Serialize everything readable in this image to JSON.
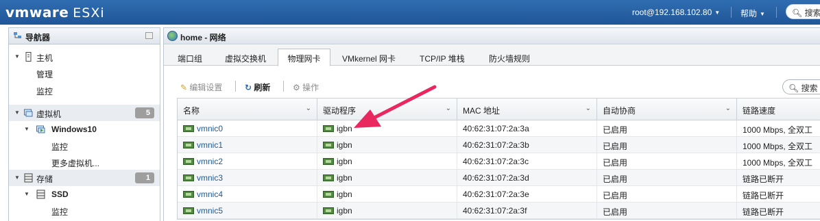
{
  "topbar": {
    "logo_vm": "vmware",
    "logo_esxi": "ESXi",
    "user": "root@192.168.102.80",
    "help": "帮助",
    "search": "搜索"
  },
  "navigator": {
    "title": "导航器",
    "items": [
      {
        "label": "主机"
      },
      {
        "label": "管理"
      },
      {
        "label": "监控"
      },
      {
        "label": "虚拟机",
        "count": "5"
      },
      {
        "label": "Windows10"
      },
      {
        "label": "监控"
      },
      {
        "label": "更多虚拟机..."
      },
      {
        "label": "存储",
        "count": "1"
      },
      {
        "label": "SSD"
      },
      {
        "label": "监控"
      }
    ]
  },
  "main": {
    "title": "home - 网络",
    "tabs": [
      {
        "label": "端口组"
      },
      {
        "label": "虚拟交换机"
      },
      {
        "label": "物理网卡"
      },
      {
        "label": "VMkernel 网卡"
      },
      {
        "label": "TCP/IP 堆栈"
      },
      {
        "label": "防火墙规则"
      }
    ],
    "toolbar": {
      "edit": "编辑设置",
      "refresh": "刷新",
      "actions": "操作",
      "search": "搜索"
    }
  },
  "table": {
    "columns": [
      "名称",
      "驱动程序",
      "MAC 地址",
      "自动协商",
      "链路速度"
    ],
    "rows": [
      {
        "name": "vmnic0",
        "driver": "igbn",
        "mac": "40:62:31:07:2a:3a",
        "autoneg": "已启用",
        "speed": "1000 Mbps, 全双工"
      },
      {
        "name": "vmnic1",
        "driver": "igbn",
        "mac": "40:62:31:07:2a:3b",
        "autoneg": "已启用",
        "speed": "1000 Mbps, 全双工"
      },
      {
        "name": "vmnic2",
        "driver": "igbn",
        "mac": "40:62:31:07:2a:3c",
        "autoneg": "已启用",
        "speed": "1000 Mbps, 全双工"
      },
      {
        "name": "vmnic3",
        "driver": "igbn",
        "mac": "40:62:31:07:2a:3d",
        "autoneg": "已启用",
        "speed": "链路已断开"
      },
      {
        "name": "vmnic4",
        "driver": "igbn",
        "mac": "40:62:31:07:2a:3e",
        "autoneg": "已启用",
        "speed": "链路已断开"
      },
      {
        "name": "vmnic5",
        "driver": "igbn",
        "mac": "40:62:31:07:2a:3f",
        "autoneg": "已启用",
        "speed": "链路已断开"
      }
    ]
  },
  "colors": {
    "topbar": "#2b66a8",
    "link": "#1d5a98",
    "annotation_arrow": "#e8285f"
  }
}
